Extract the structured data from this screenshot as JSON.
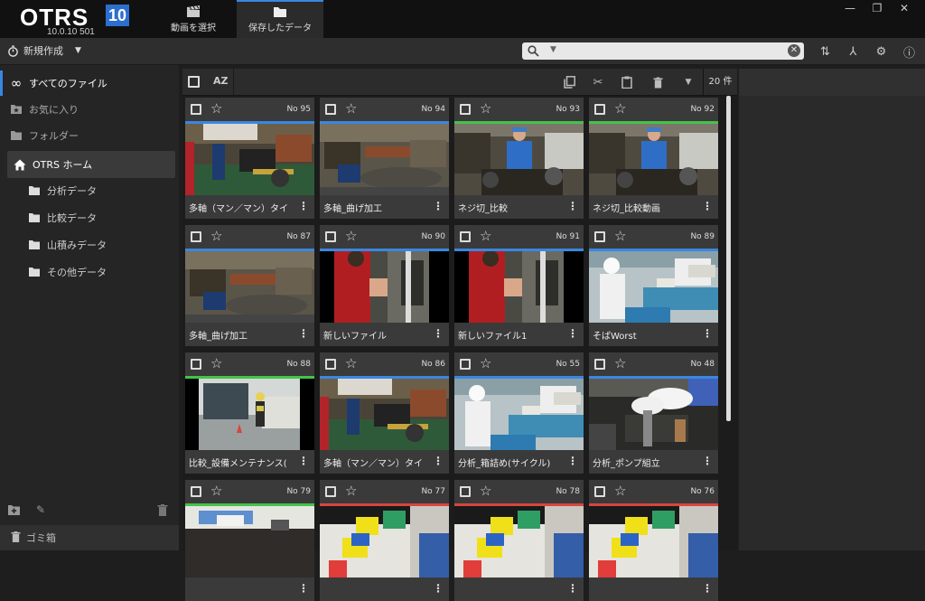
{
  "app": {
    "logo": "OTRS",
    "logo_badge": "10",
    "version": "10.0.10  501"
  },
  "tabs": [
    {
      "label": "動画を選択",
      "icon": "clapperboard-icon"
    },
    {
      "label": "保存したデータ",
      "icon": "folder-icon",
      "active": true
    }
  ],
  "window_controls": [
    "minimize",
    "restore",
    "close"
  ],
  "toolbar": {
    "new_label": "新規作成",
    "search_placeholder": "",
    "icons": [
      "sort-icon",
      "merge-icon",
      "gear-icon",
      "info-icon"
    ]
  },
  "sidebar": {
    "items": [
      {
        "label": "すべてのファイル",
        "icon": "infinity-icon"
      },
      {
        "label": "お気に入り",
        "icon": "star-folder-icon"
      },
      {
        "label": "フォルダー",
        "icon": "folder-icon"
      },
      {
        "label": "OTRS ホーム",
        "icon": "home-icon"
      },
      {
        "label": "分析データ",
        "icon": "folder-icon"
      },
      {
        "label": "比較データ",
        "icon": "folder-icon"
      },
      {
        "label": "山積みデータ",
        "icon": "folder-icon"
      },
      {
        "label": "その他データ",
        "icon": "folder-icon"
      }
    ],
    "trash_label": "ゴミ箱"
  },
  "content_toolbar": {
    "sort_label": "AZ",
    "count_label": "20 件",
    "icons": [
      "copy-icon",
      "cut-icon",
      "paste-icon",
      "trash-icon",
      "dropdown-icon"
    ]
  },
  "colors": {
    "accent_blue": "#3a87e0",
    "accent_green": "#44c24a",
    "accent_red": "#d8453f"
  },
  "cards": [
    {
      "no": "No 95",
      "title": "多軸（マン／マン）タイ",
      "line": "#3a87e0",
      "thumb": "factory1"
    },
    {
      "no": "No 94",
      "title": "多軸_曲げ加工",
      "line": "#3a87e0",
      "thumb": "factory2"
    },
    {
      "no": "No 93",
      "title": "ネジ切_比較",
      "line": "#44c24a",
      "thumb": "worker"
    },
    {
      "no": "No 92",
      "title": "ネジ切_比較動画",
      "line": "#44c24a",
      "thumb": "worker"
    },
    {
      "no": "No 87",
      "title": "多軸_曲げ加工",
      "line": "#3a87e0",
      "thumb": "factory2"
    },
    {
      "no": "No 90",
      "title": "新しいファイル",
      "line": "#3a87e0",
      "thumb": "redshirt"
    },
    {
      "no": "No 91",
      "title": "新しいファイル1",
      "line": "#3a87e0",
      "thumb": "redshirt"
    },
    {
      "no": "No 89",
      "title": "そばWorst",
      "line": "#3a87e0",
      "thumb": "foodline"
    },
    {
      "no": "No 88",
      "title": "比較_設備メンテナンス(",
      "line": "#44c24a",
      "thumb": "maintenance"
    },
    {
      "no": "No 86",
      "title": "多軸（マン／マン）タイ",
      "line": "#3a87e0",
      "thumb": "factory1"
    },
    {
      "no": "No 55",
      "title": "分析_箱詰め(サイクル)",
      "line": "#3a87e0",
      "thumb": "foodline"
    },
    {
      "no": "No 48",
      "title": "分析_ポンプ組立",
      "line": "#3a87e0",
      "thumb": "gloves"
    },
    {
      "no": "No 79",
      "title": "",
      "line": "#44c24a",
      "thumb": "desk"
    },
    {
      "no": "No 77",
      "title": "",
      "line": "#d8453f",
      "thumb": "yellowbox"
    },
    {
      "no": "No 78",
      "title": "",
      "line": "#d8453f",
      "thumb": "yellowbox"
    },
    {
      "no": "No 76",
      "title": "",
      "line": "#d8453f",
      "thumb": "yellowbox"
    }
  ]
}
